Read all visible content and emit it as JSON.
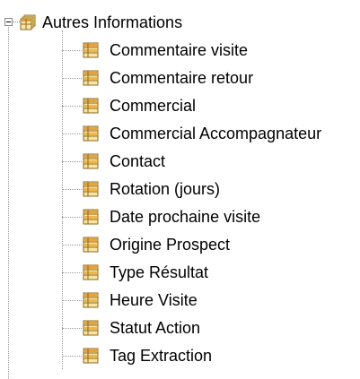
{
  "tree": {
    "root": {
      "label": "Autres Informations",
      "icon": "table-folder-icon",
      "expanded": true
    },
    "children": [
      {
        "label": "Commentaire visite",
        "icon": "field-icon"
      },
      {
        "label": "Commentaire retour",
        "icon": "field-icon"
      },
      {
        "label": "Commercial",
        "icon": "field-icon"
      },
      {
        "label": "Commercial Accompagnateur",
        "icon": "field-icon"
      },
      {
        "label": "Contact",
        "icon": "field-icon"
      },
      {
        "label": "Rotation (jours)",
        "icon": "field-icon"
      },
      {
        "label": "Date prochaine visite",
        "icon": "field-icon"
      },
      {
        "label": "Origine Prospect",
        "icon": "field-icon"
      },
      {
        "label": "Type Résultat",
        "icon": "field-icon"
      },
      {
        "label": "Heure Visite",
        "icon": "field-icon"
      },
      {
        "label": "Statut Action",
        "icon": "field-icon"
      },
      {
        "label": "Tag Extraction",
        "icon": "field-icon"
      }
    ]
  }
}
